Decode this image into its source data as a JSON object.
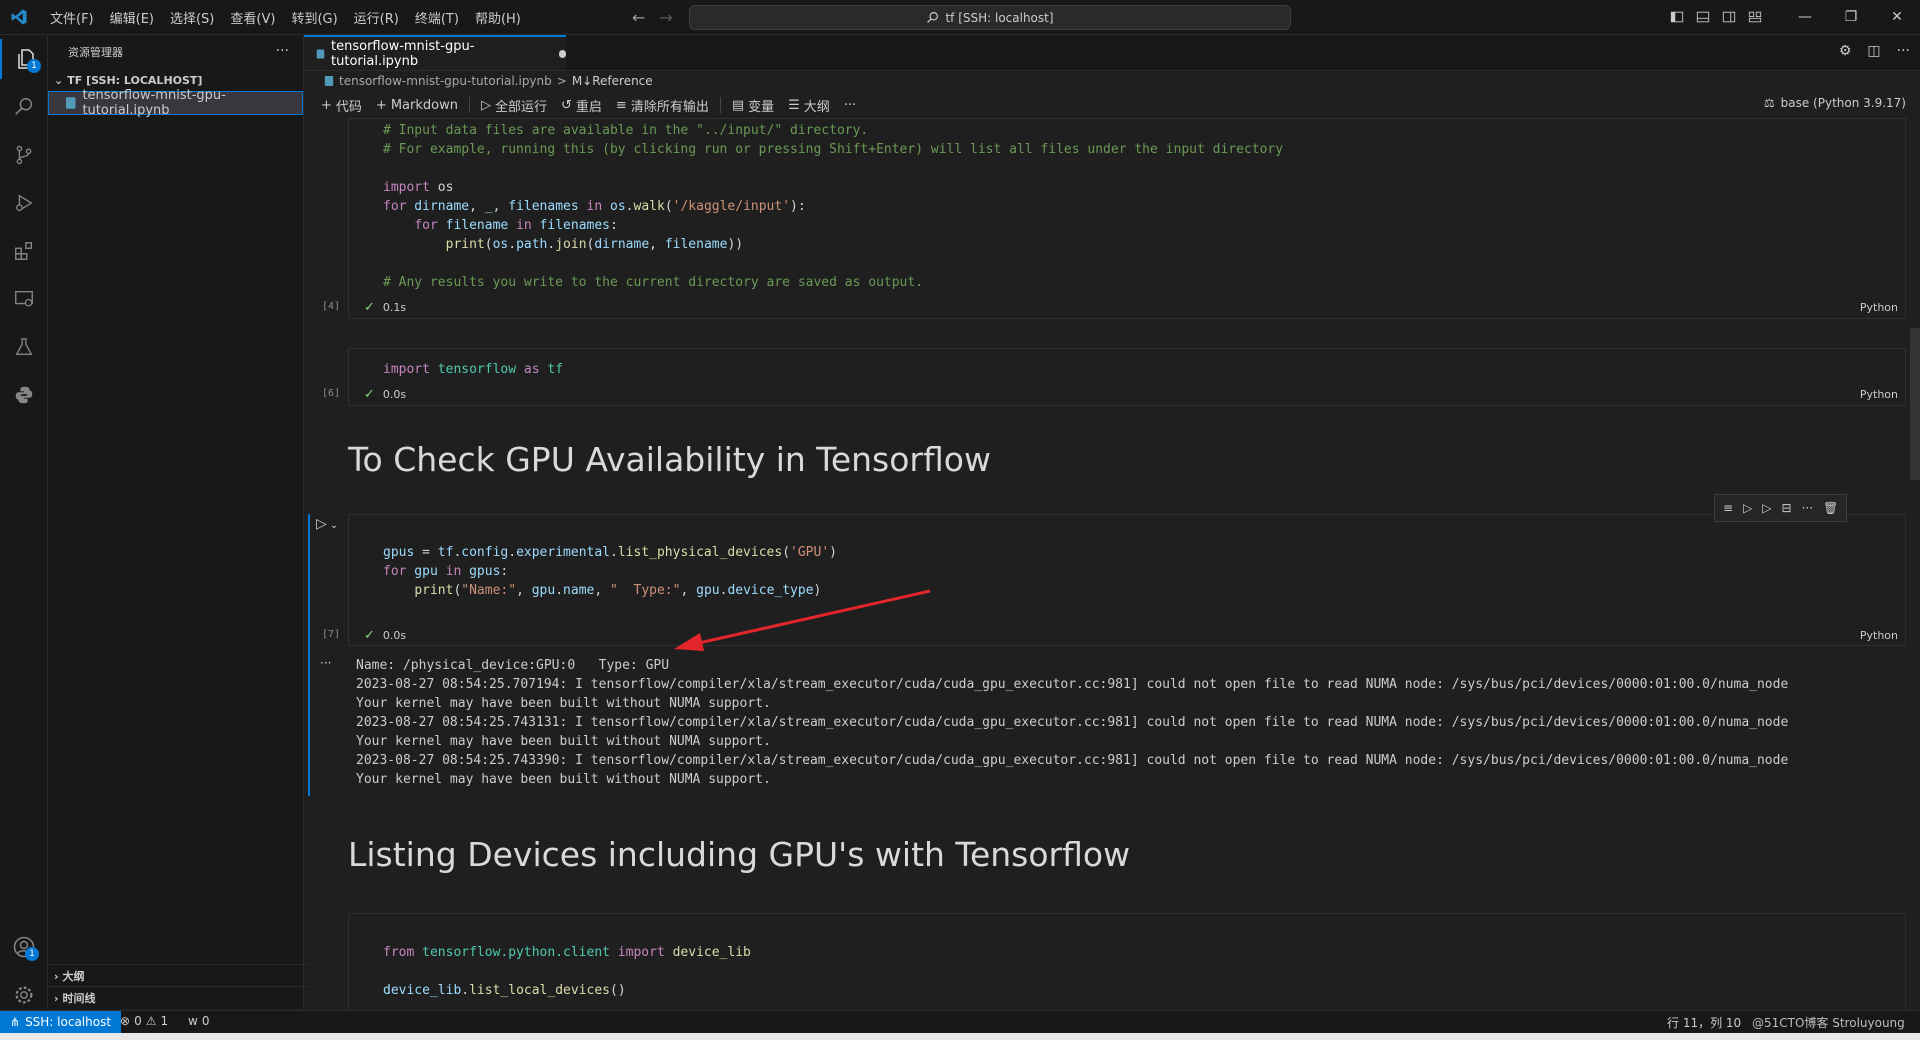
{
  "menu": [
    "文件(F)",
    "编辑(E)",
    "选择(S)",
    "查看(V)",
    "转到(G)",
    "运行(R)",
    "终端(T)",
    "帮助(H)"
  ],
  "command_center": "tf [SSH: localhost]",
  "sidebar": {
    "title": "资源管理器",
    "section": "TF [SSH: LOCALHOST]",
    "file": "tensorflow-mnist-gpu-tutorial.ipynb",
    "outline": "大纲",
    "timeline": "时间线"
  },
  "tab": {
    "label": "tensorflow-mnist-gpu-tutorial.ipynb"
  },
  "breadcrumb": {
    "file": "tensorflow-mnist-gpu-tutorial.ipynb",
    "sep": ">",
    "section": "M↓Reference"
  },
  "toolbar": {
    "code": "代码",
    "markdown": "Markdown",
    "run_all": "全部运行",
    "restart": "重启",
    "clear_outputs": "清除所有输出",
    "variables": "变量",
    "outline": "大纲",
    "kernel": "base (Python 3.9.17)"
  },
  "cells": [
    {
      "count": "[4]",
      "time": "0.1s",
      "lang": "Python",
      "lines": [
        "# Input data files are available in the \"../input/\" directory.",
        "# For example, running this (by clicking run or pressing Shift+Enter) will list all files under the input directory",
        "",
        "import os",
        "for dirname, _, filenames in os.walk('/kaggle/input'):",
        "    for filename in filenames:",
        "        print(os.path.join(dirname, filename))",
        "",
        "# Any results you write to the current directory are saved as output."
      ]
    },
    {
      "count": "[6]",
      "time": "0.0s",
      "lang": "Python",
      "lines": [
        "import tensorflow as tf"
      ]
    },
    {
      "count": "[7]",
      "time": "0.0s",
      "lang": "Python",
      "lines": [
        "gpus = tf.config.experimental.list_physical_devices('GPU')",
        "for gpu in gpus:",
        "    print(\"Name:\", gpu.name, \"  Type:\", gpu.device_type)"
      ]
    },
    {
      "lines": [
        "from tensorflow.python.client import device_lib",
        "",
        "device_lib.list_local_devices()"
      ]
    }
  ],
  "headings": [
    "To Check GPU Availability in Tensorflow",
    "Listing Devices including GPU's with Tensorflow"
  ],
  "output_lines": [
    "Name: /physical_device:GPU:0   Type: GPU",
    "2023-08-27 08:54:25.707194: I tensorflow/compiler/xla/stream_executor/cuda/cuda_gpu_executor.cc:981] could not open file to read NUMA node: /sys/bus/pci/devices/0000:01:00.0/numa_node",
    "Your kernel may have been built without NUMA support.",
    "2023-08-27 08:54:25.743131: I tensorflow/compiler/xla/stream_executor/cuda/cuda_gpu_executor.cc:981] could not open file to read NUMA node: /sys/bus/pci/devices/0000:01:00.0/numa_node",
    "Your kernel may have been built without NUMA support.",
    "2023-08-27 08:54:25.743390: I tensorflow/compiler/xla/stream_executor/cuda/cuda_gpu_executor.cc:981] could not open file to read NUMA node: /sys/bus/pci/devices/0000:01:00.0/numa_node",
    "Your kernel may have been built without NUMA support."
  ],
  "output_more": "···",
  "statusbar": {
    "remote": "SSH: localhost",
    "errors": "0",
    "warnings": "1",
    "ports": "0",
    "position": "行 11，列 10",
    "watermark": "@51CTO博客 Stroluyoung"
  },
  "colors": {
    "accent": "#0078d4",
    "arrow": "#e3262b",
    "check": "#89d185"
  }
}
